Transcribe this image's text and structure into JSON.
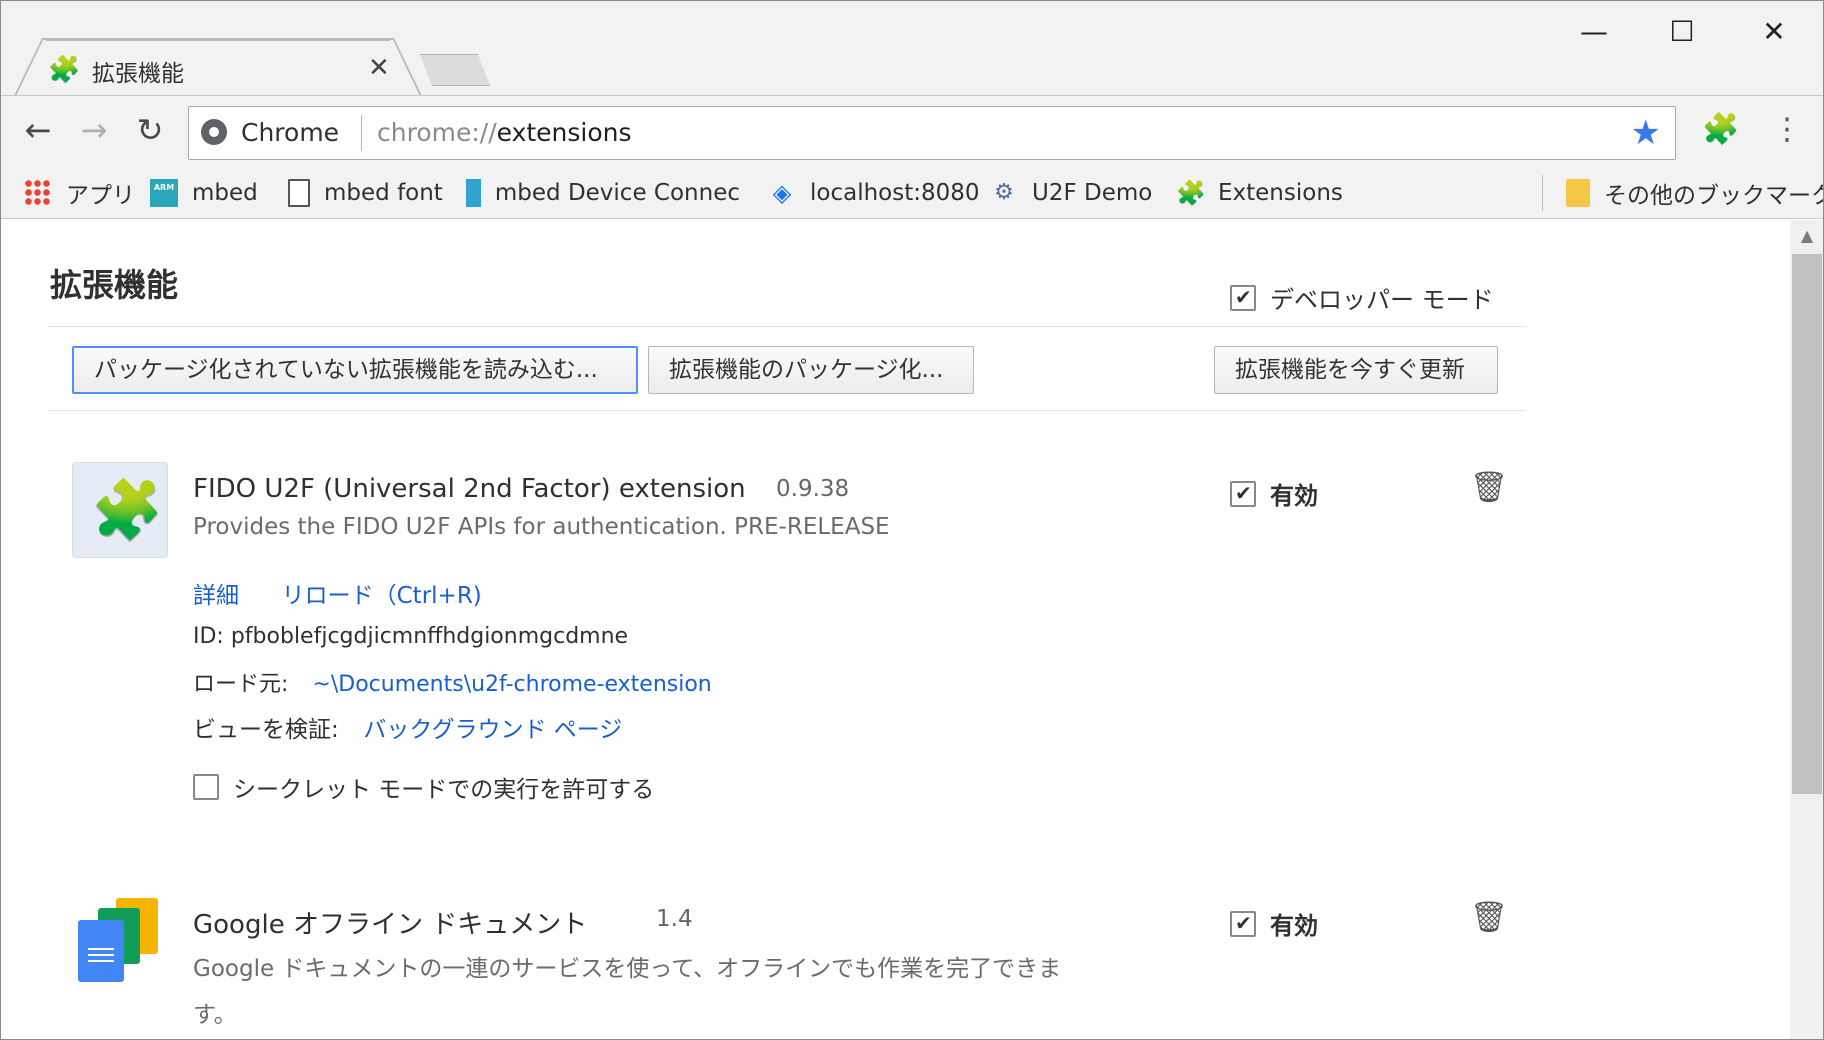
{
  "window": {
    "minimize_glyph": "—",
    "maximize_glyph": "☐",
    "close_glyph": "✕"
  },
  "tab": {
    "title": "拡張機能",
    "icon": "puzzle-icon",
    "close_glyph": "✕"
  },
  "toolbar": {
    "back_glyph": "←",
    "forward_glyph": "→",
    "reload_glyph": "↻",
    "omnibox_chip": "Chrome",
    "url_scheme": "chrome://",
    "url_path": "extensions",
    "star_glyph": "★",
    "star_color": "#3b78e7",
    "menu_glyph": "⋮"
  },
  "bookmarks": [
    {
      "label": "アプリ",
      "icon": "apps-grid-icon"
    },
    {
      "label": "mbed",
      "icon": "arm-mbed-icon"
    },
    {
      "label": "mbed font",
      "icon": "document-icon"
    },
    {
      "label": "mbed Device Connec",
      "icon": "mbed-icon"
    },
    {
      "label": "localhost:8080",
      "icon": "localhost-icon"
    },
    {
      "label": "U2F Demo",
      "icon": "u2f-icon"
    },
    {
      "label": "Extensions",
      "icon": "puzzle-icon"
    },
    {
      "label": "その他のブックマーク",
      "icon": "folder-icon"
    }
  ],
  "page": {
    "title": "拡張機能",
    "developer_mode_label": "デベロッパー モード",
    "developer_mode_checked": true,
    "buttons": {
      "load_unpacked": "パッケージ化されていない拡張機能を読み込む...",
      "pack_extension": "拡張機能のパッケージ化...",
      "update_now": "拡張機能を今すぐ更新"
    }
  },
  "extensions": [
    {
      "name": "FIDO U2F (Universal 2nd Factor) extension",
      "version": "0.9.38",
      "description": "Provides the FIDO U2F APIs for authentication. PRE-RELEASE",
      "details_link": "詳細",
      "reload_link": "リロード（Ctrl+R)",
      "id_label": "ID:",
      "id_value": "pfboblefjcgdjicmnffhdgionmgcdmne",
      "loaded_from_label": "ロード元:",
      "loaded_from_value": "~\\Documents\\u2f-chrome-extension",
      "inspect_label": "ビューを検証:",
      "inspect_link": "バックグラウンド ページ",
      "incognito_label": "シークレット モードでの実行を許可する",
      "incognito_checked": false,
      "enabled_label": "有効",
      "enabled": true
    },
    {
      "name": "Google オフライン ドキュメント",
      "version": "1.4",
      "description_line1": "Google ドキュメントの一連のサービスを使って、オフラインでも作業を完了できま",
      "description_line2": "す。",
      "enabled_label": "有効",
      "enabled": true
    }
  ],
  "glyphs": {
    "trash": "🗑",
    "scroll_up": "▲",
    "puzzle": "✚"
  }
}
